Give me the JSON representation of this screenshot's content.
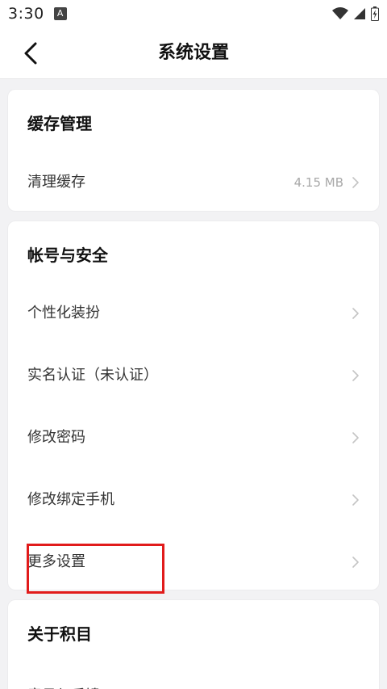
{
  "status_bar": {
    "time": "3:30",
    "notification_glyph": "A"
  },
  "header": {
    "title": "系统设置"
  },
  "sections": [
    {
      "title": "缓存管理",
      "items": [
        {
          "label": "清理缓存",
          "value": "4.15 MB"
        }
      ]
    },
    {
      "title": "帐号与安全",
      "items": [
        {
          "label": "个性化装扮"
        },
        {
          "label": "实名认证（未认证）"
        },
        {
          "label": "修改密码"
        },
        {
          "label": "修改绑定手机"
        },
        {
          "label": "更多设置"
        }
      ]
    },
    {
      "title": "关于积目",
      "items": [
        {
          "label": "意见与反馈"
        }
      ]
    }
  ],
  "colors": {
    "background": "#f2f2f4",
    "card": "#ffffff",
    "highlight": "#e11b1b",
    "secondary_text": "#a8a8a8"
  }
}
